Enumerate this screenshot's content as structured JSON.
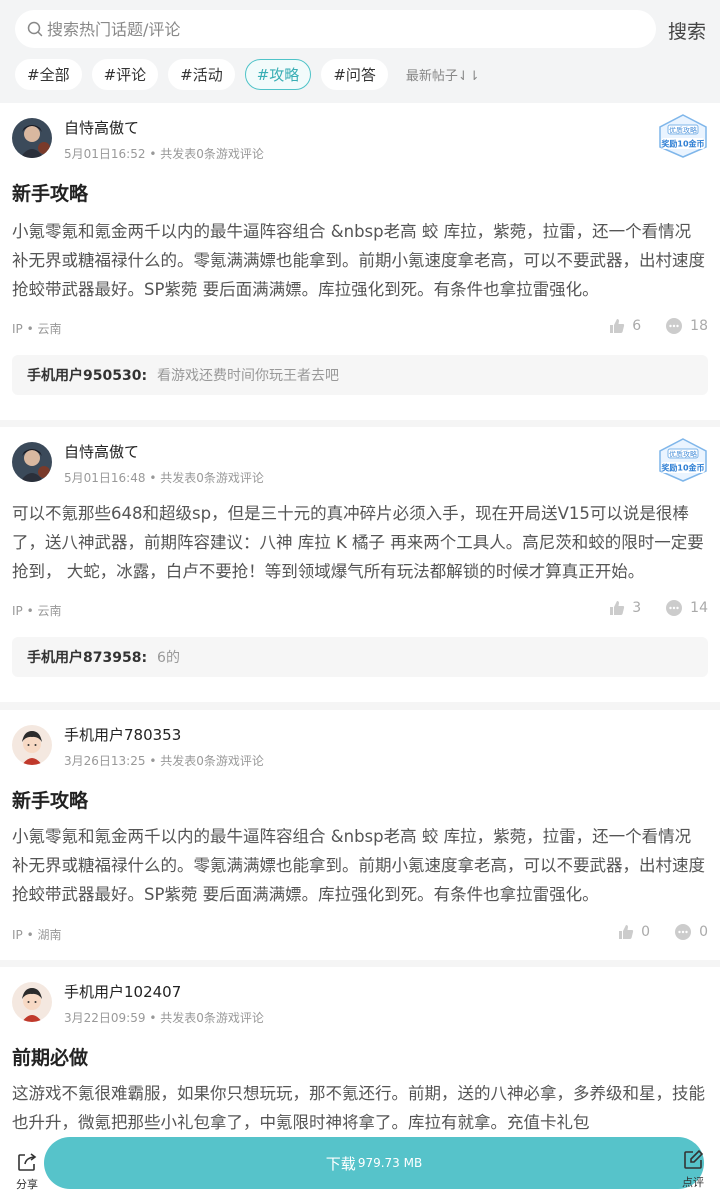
{
  "search": {
    "placeholder": "搜索热门话题/评论",
    "button": "搜索"
  },
  "tabs": [
    {
      "label": "#全部",
      "active": false
    },
    {
      "label": "#评论",
      "active": false
    },
    {
      "label": "#活动",
      "active": false
    },
    {
      "label": "#攻略",
      "active": true
    },
    {
      "label": "#问答",
      "active": false
    }
  ],
  "sort_label": "最新帖子⇃⇂",
  "badge": {
    "line1": "优质攻略",
    "line2": "奖励10金币"
  },
  "posts": [
    {
      "author": "自恃高傲て",
      "date": "5月01日16:52",
      "reviews": "共发表0条游戏评论",
      "title": "新手攻略",
      "body": "小氪零氪和氪金两千以内的最牛逼阵容组合 &nbsp老高 蛟 库拉，紫菀，拉雷，还一个看情况补无界或糖福禄什么的。零氪满满嫖也能拿到。前期小氪速度拿老高，可以不要武器，出村速度抢蛟带武器最好。SP紫菀 要后面满满嫖。库拉强化到死。有条件也拿拉雷强化。",
      "ip": "IP • 云南",
      "likes": "6",
      "comments": "18",
      "reply_user": "手机用户950530:",
      "reply_text": "看游戏还费时间你玩王者去吧"
    },
    {
      "author": "自恃高傲て",
      "date": "5月01日16:48",
      "reviews": "共发表0条游戏评论",
      "title": "",
      "body": "可以不氪那些648和超级sp，但是三十元的真冲碎片必须入手，现在开局送V15可以说是很棒了，送八神武器，前期阵容建议：八神 库拉 K 橘子 再来两个工具人。高尼茨和蛟的限时一定要抢到， 大蛇，冰露，白卢不要抢！等到领域爆气所有玩法都解锁的时候才算真正开始。",
      "ip": "IP • 云南",
      "likes": "3",
      "comments": "14",
      "reply_user": "手机用户873958:",
      "reply_text": "6的"
    },
    {
      "author": "手机用户780353",
      "date": "3月26日13:25",
      "reviews": "共发表0条游戏评论",
      "title": "新手攻略",
      "body": "小氪零氪和氪金两千以内的最牛逼阵容组合 &nbsp老高 蛟 库拉，紫菀，拉雷，还一个看情况补无界或糖福禄什么的。零氪满满嫖也能拿到。前期小氪速度拿老高，可以不要武器，出村速度抢蛟带武器最好。SP紫菀 要后面满满嫖。库拉强化到死。有条件也拿拉雷强化。",
      "ip": "IP • 湖南",
      "likes": "0",
      "comments": "0"
    },
    {
      "author": "手机用户102407",
      "date": "3月22日09:59",
      "reviews": "共发表0条游戏评论",
      "title": "前期必做",
      "body": "这游戏不氪很难霸服，如果你只想玩玩，那不氪还行。前期，送的八神必拿，多养级和星，技能也升升，微氪把那些小礼包拿了，中氪限时神将拿了。库拉有就拿。充值卡礼包"
    }
  ],
  "bottom": {
    "share": "分享",
    "download": "下载",
    "size": "979.73 MB",
    "review": "点评"
  },
  "colors": {
    "accent": "#56c3ca",
    "active_tab": "#39aeb5"
  }
}
